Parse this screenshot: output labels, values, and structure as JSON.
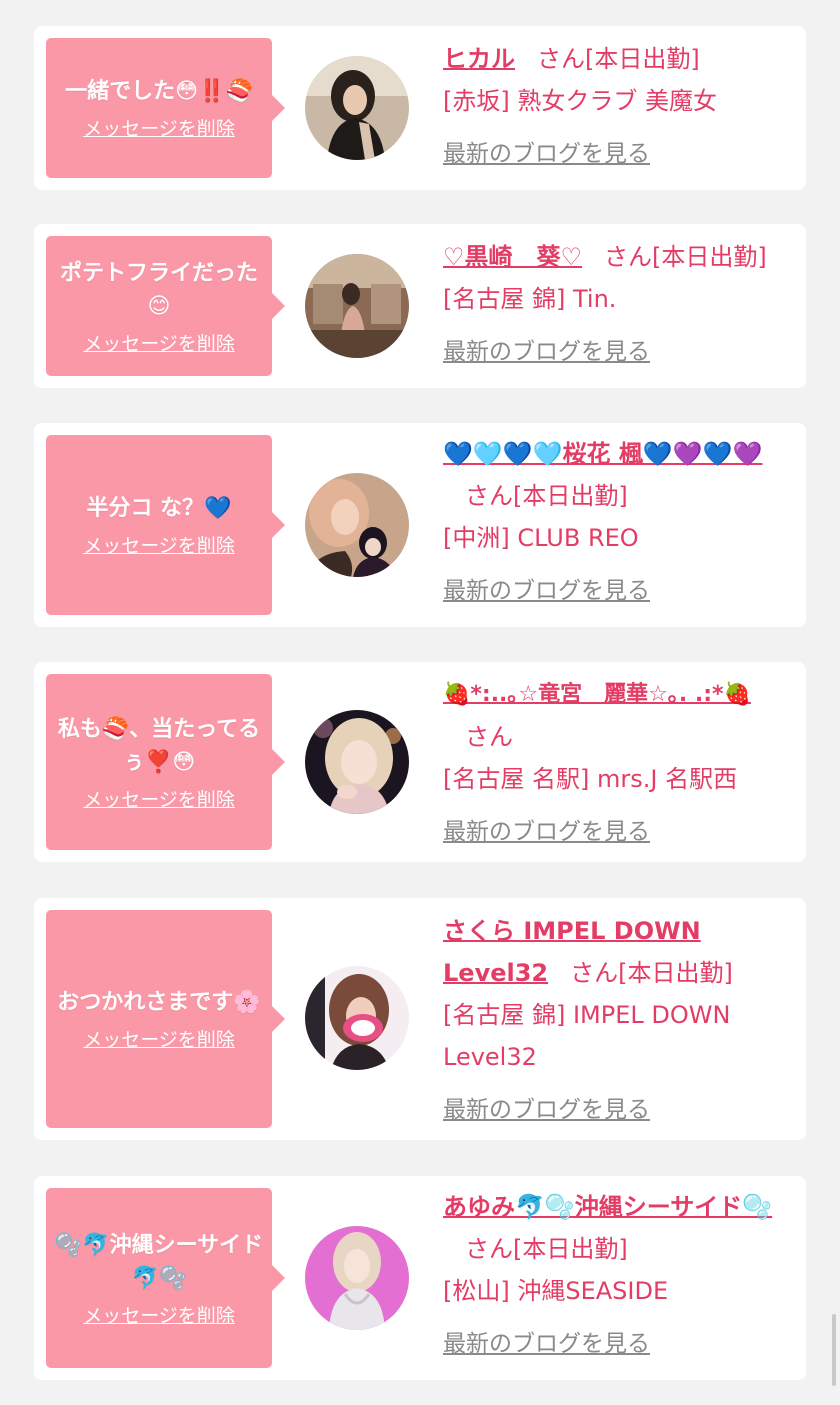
{
  "messages": [
    {
      "bubble": "一緒でした😳‼️🍣",
      "delete_label": "メッセージを削除",
      "name": "ヒカル",
      "san": "さん",
      "status": "[本日出勤]",
      "shop": "[赤坂] 熟女クラブ 美魔女",
      "blog_label": "最新のブログを見る"
    },
    {
      "bubble": "ポテトフライだった😊",
      "delete_label": "メッセージを削除",
      "name": "♡黒崎　葵♡",
      "san": "さん",
      "status": "[本日出勤]",
      "shop": "[名古屋 錦] Tin.",
      "blog_label": "最新のブログを見る"
    },
    {
      "bubble": "半分コ な？💙",
      "delete_label": "メッセージを削除",
      "name": "💙🩵💙🩵桜花 楓💙💜💙💜",
      "san": "さん",
      "status": "[本日出勤]",
      "shop": "[中洲] CLUB REO",
      "blog_label": "最新のブログを見る"
    },
    {
      "bubble": "私も🍣、当たってるぅ❣️😳",
      "delete_label": "メッセージを削除",
      "name": "🍓*:..｡☆竜宮　麗華☆｡. .:*🍓",
      "san": "さん",
      "status": "",
      "shop": "[名古屋 名駅] mrs.J 名駅西",
      "blog_label": "最新のブログを見る"
    },
    {
      "bubble": "おつかれさまです🌸",
      "delete_label": "メッセージを削除",
      "name": "さくら IMPEL DOWN Level32",
      "san": "さん",
      "status": "[本日出勤]",
      "shop": "[名古屋 錦] IMPEL DOWN Level32",
      "blog_label": "最新のブログを見る"
    },
    {
      "bubble": "🫧🐬沖縄シーサイド🐬🫧",
      "delete_label": "メッセージを削除",
      "name": "あゆみ🐬🫧沖縄シーサイド🫧",
      "san": "さん",
      "status": "[本日出勤]",
      "shop": "[松山] 沖縄SEASIDE",
      "blog_label": "最新のブログを見る"
    }
  ]
}
